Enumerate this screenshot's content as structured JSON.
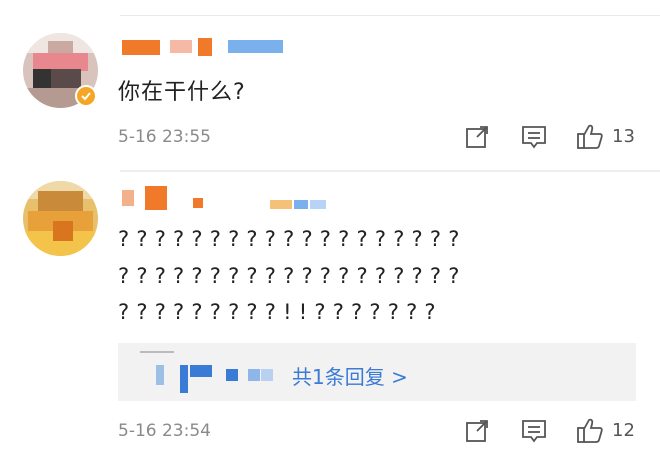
{
  "comments": [
    {
      "text": "你在干什么?",
      "time": "5-16 23:55",
      "likes": "13",
      "verified": true
    },
    {
      "lines": [
        "???????????????????",
        "???????????????????",
        "?????????!!???????"
      ],
      "time": "5-16 23:54",
      "likes": "12",
      "reply_summary": "共1条回复 >"
    }
  ],
  "icons": {
    "share": "share-external-icon",
    "reply": "comment-bubble-icon",
    "like": "thumbs-up-icon",
    "verified": "verified-badge-icon"
  },
  "colors": {
    "link": "#3a7bd5",
    "meta": "#8a8a8a",
    "badge": "#f5a623"
  }
}
